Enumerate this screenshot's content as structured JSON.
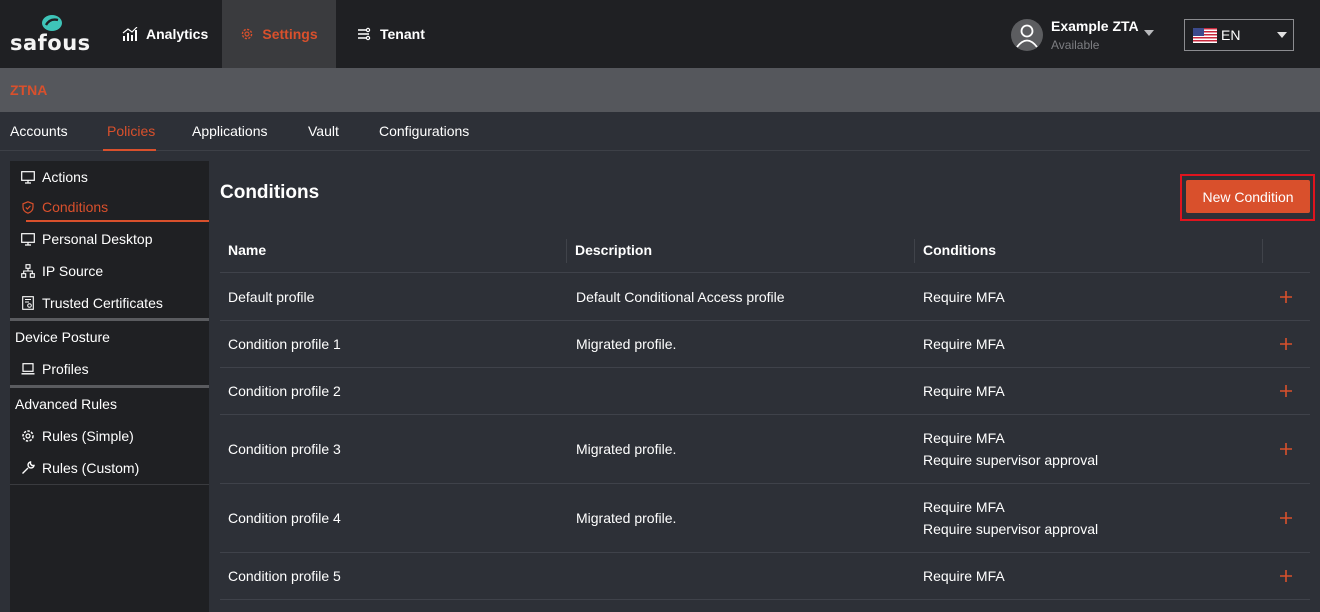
{
  "brand": {
    "name": "safous"
  },
  "topnav": {
    "analytics_label": "Analytics",
    "settings_label": "Settings",
    "tenant_label": "Tenant"
  },
  "user": {
    "name": "Example ZTA",
    "status": "Available"
  },
  "language": {
    "code": "EN"
  },
  "section": {
    "title": "ZTNA"
  },
  "subtabs": [
    "Accounts",
    "Policies",
    "Applications",
    "Vault",
    "Configurations"
  ],
  "sidebar": {
    "items": [
      {
        "label": "Actions",
        "icon": "monitor-icon"
      },
      {
        "label": "Conditions",
        "icon": "shield-icon"
      },
      {
        "label": "Personal Desktop",
        "icon": "monitor-icon"
      },
      {
        "label": "IP Source",
        "icon": "network-icon"
      },
      {
        "label": "Trusted Certificates",
        "icon": "certificate-icon"
      }
    ],
    "device_posture": {
      "title": "Device Posture",
      "items": [
        {
          "label": "Profiles",
          "icon": "laptop-icon"
        }
      ]
    },
    "advanced_rules": {
      "title": "Advanced Rules",
      "items": [
        {
          "label": "Rules (Simple)",
          "icon": "gear-icon"
        },
        {
          "label": "Rules (Custom)",
          "icon": "wrench-icon"
        }
      ]
    }
  },
  "main": {
    "title": "Conditions",
    "new_button_label": "New Condition",
    "columns": [
      "Name",
      "Description",
      "Conditions"
    ],
    "rows": [
      {
        "name": "Default profile",
        "description": "Default Conditional Access profile",
        "conditions": [
          "Require MFA"
        ]
      },
      {
        "name": "Condition profile 1",
        "description": "Migrated profile.",
        "conditions": [
          "Require MFA"
        ]
      },
      {
        "name": "Condition profile 2",
        "description": "",
        "conditions": [
          "Require MFA"
        ]
      },
      {
        "name": "Condition profile 3",
        "description": "Migrated profile.",
        "conditions": [
          "Require MFA",
          "Require supervisor approval"
        ]
      },
      {
        "name": "Condition profile 4",
        "description": "Migrated profile.",
        "conditions": [
          "Require MFA",
          "Require supervisor approval"
        ]
      },
      {
        "name": "Condition profile 5",
        "description": "",
        "conditions": [
          "Require MFA"
        ]
      }
    ]
  },
  "colors": {
    "accent": "#d9502c",
    "topbar": "#1f2023",
    "background": "#2d3037",
    "highlight_frame": "#e0141e"
  }
}
